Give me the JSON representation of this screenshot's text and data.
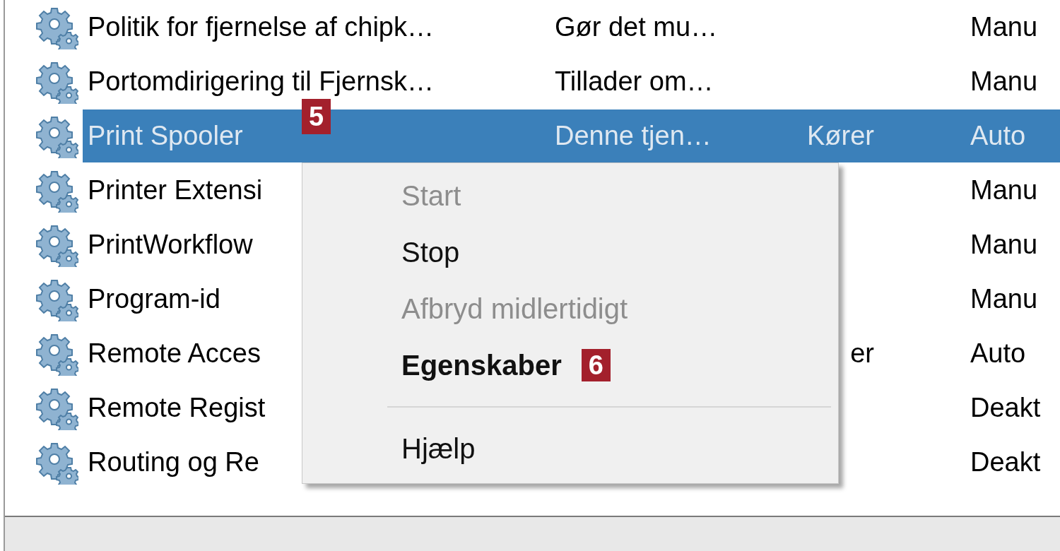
{
  "services": {
    "rows": [
      {
        "name": "Politik for fjernelse af chipk…",
        "description": "Gør det mu…",
        "status": "",
        "startup": "Manu",
        "selected": false
      },
      {
        "name": "Portomdirigering til Fjernsk…",
        "description": "Tillader om…",
        "status": "",
        "startup": "Manu",
        "selected": false
      },
      {
        "name": "Print Spooler",
        "description": "Denne tjen…",
        "status": "Kører",
        "startup": "Auto",
        "selected": true,
        "callout": "5"
      },
      {
        "name": "Printer Extensi",
        "description": "",
        "status": "",
        "startup": "Manu",
        "selected": false
      },
      {
        "name": "PrintWorkflow",
        "description": "",
        "status": "",
        "startup": "Manu",
        "selected": false
      },
      {
        "name": "Program-id",
        "description": "",
        "status": "",
        "startup": "Manu",
        "selected": false
      },
      {
        "name": "Remote Acces",
        "description": "",
        "status": "er",
        "startup": "Auto",
        "selected": false
      },
      {
        "name": "Remote Regist",
        "description": "",
        "status": "",
        "startup": "Deakt",
        "selected": false
      },
      {
        "name": "Routing og Re",
        "description": "",
        "status": "",
        "startup": "Deakt",
        "selected": false
      }
    ]
  },
  "context_menu": {
    "items": [
      {
        "kind": "item",
        "label": "Start",
        "disabled": true,
        "bold": false
      },
      {
        "kind": "item",
        "label": "Stop",
        "disabled": false,
        "bold": false
      },
      {
        "kind": "item",
        "label": "Afbryd midlertidigt",
        "disabled": true,
        "bold": false
      },
      {
        "kind": "item",
        "label": "Egenskaber",
        "disabled": false,
        "bold": true,
        "callout": "6"
      },
      {
        "kind": "separator"
      },
      {
        "kind": "item",
        "label": "Hjælp",
        "disabled": false,
        "bold": false
      }
    ]
  }
}
